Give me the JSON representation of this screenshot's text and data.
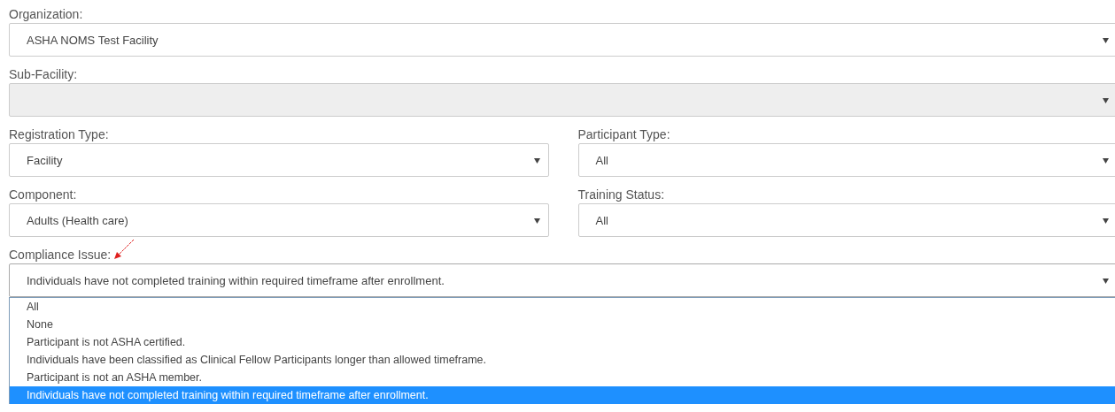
{
  "form": {
    "rows": [
      {
        "fields": [
          {
            "label": "Organization:",
            "value": "ASHA NOMS Test Facility",
            "disabled": false,
            "marked": false
          }
        ]
      },
      {
        "fields": [
          {
            "label": "Sub-Facility:",
            "disabled": true,
            "marked": false
          }
        ]
      },
      {
        "fields": [
          {
            "label": "Registration Type:",
            "value": "Facility",
            "disabled": false,
            "marked": false
          },
          {
            "label": "Participant Type:",
            "value": "All",
            "disabled": false,
            "marked": false
          }
        ]
      },
      {
        "fields": [
          {
            "label": "Component:",
            "value": "Adults (Health care)",
            "disabled": false,
            "marked": false
          },
          {
            "label": "Training Status:",
            "value": "All",
            "disabled": false,
            "marked": false
          }
        ]
      },
      {
        "fields": [
          {
            "label": "Compliance Issue:",
            "value": "Individuals have not completed training within required timeframe after enrollment.",
            "disabled": false,
            "marked": true,
            "options": [
              {
                "label": "All",
                "selected": false
              },
              {
                "label": "None",
                "selected": false
              },
              {
                "label": "Participant is not ASHA certified.",
                "selected": false
              },
              {
                "label": "Individuals have been classified as Clinical Fellow Participants longer than allowed timeframe.",
                "selected": false
              },
              {
                "label": "Participant is not an ASHA member.",
                "selected": false
              },
              {
                "label": "Individuals have not completed training within required timeframe after enrollment.",
                "selected": true
              }
            ]
          }
        ]
      }
    ]
  }
}
